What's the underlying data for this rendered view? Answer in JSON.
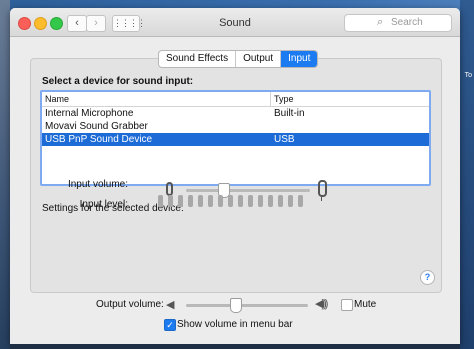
{
  "window": {
    "title": "Sound"
  },
  "search": {
    "placeholder": "Search"
  },
  "tabs": [
    {
      "label": "Sound Effects",
      "selected": false
    },
    {
      "label": "Output",
      "selected": false
    },
    {
      "label": "Input",
      "selected": true
    }
  ],
  "input": {
    "heading": "Select a device for sound input:",
    "columns": {
      "name": "Name",
      "type": "Type"
    },
    "devices": [
      {
        "name": "Internal Microphone",
        "type": "Built-in",
        "selected": false
      },
      {
        "name": "Movavi Sound Grabber",
        "type": "",
        "selected": false
      },
      {
        "name": "USB PnP Sound Device",
        "type": "USB",
        "selected": true
      }
    ],
    "settings_heading": "Settings for the selected device:",
    "input_volume_label": "Input volume:",
    "input_volume": 0.3,
    "input_level_label": "Input level:",
    "input_level_bars": 15
  },
  "help": {
    "label": "?"
  },
  "output": {
    "volume_label": "Output volume:",
    "volume": 0.4,
    "mute_label": "Mute",
    "mute_checked": false,
    "show_volume_label": "Show volume in menu bar",
    "show_volume_checked": true
  },
  "colors": {
    "accent": "#1d6bd6",
    "tab_selected": "#1c7bf0"
  },
  "icons": {
    "search": "search-icon",
    "back": "chevron-left-icon",
    "forward": "chevron-right-icon",
    "grid": "grid-icon",
    "mic": "microphone-icon",
    "speaker": "speaker-icon"
  },
  "desktop": {
    "right_text": "To"
  }
}
